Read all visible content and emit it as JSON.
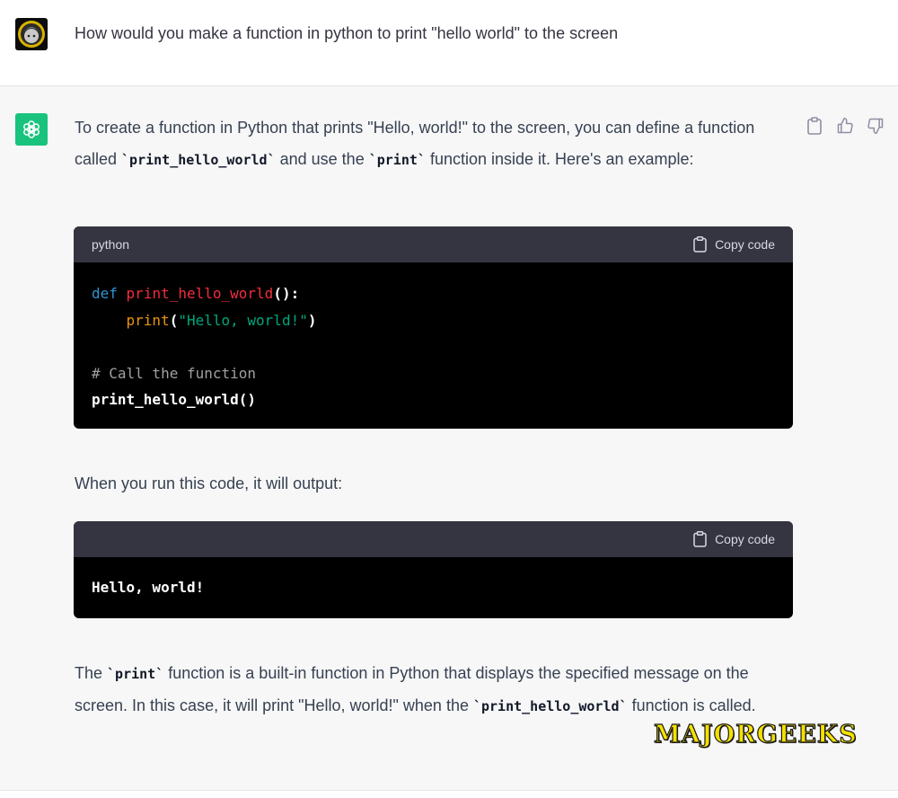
{
  "user_message": {
    "text": "How would you make a function in python to print \"hello world\" to the screen"
  },
  "assistant_message": {
    "intro": {
      "part1": "To create a function in Python that prints \"Hello, world!\" to the screen, you can define a function called ",
      "code1": "`print_hello_world`",
      "part2": " and use the ",
      "code2": "`print`",
      "part3": " function inside it. Here's an example:"
    },
    "code_block_1": {
      "language": "python",
      "copy_label": "Copy code",
      "tokens": {
        "def": "def",
        "fn_name": "print_hello_world",
        "sig_end": "():",
        "indent": "    ",
        "print_call": "print",
        "paren_open": "(",
        "string": "\"Hello, world!\"",
        "paren_close": ")",
        "comment": "# Call the function",
        "call": "print_hello_world()"
      }
    },
    "output_intro": "When you run this code, it will output:",
    "code_block_2": {
      "copy_label": "Copy code",
      "output": "Hello, world!"
    },
    "outro": {
      "part1": "The ",
      "code1": "`print`",
      "part2": " function is a built-in function in Python that displays the specified message on the screen. In this case, it will print \"Hello, world!\" when the ",
      "code2": "`print_hello_world`",
      "part3": " function is called."
    },
    "actions": [
      "clipboard-icon",
      "thumbs-up-icon",
      "thumbs-down-icon"
    ]
  },
  "watermark": "MAJORGEEKS",
  "colors": {
    "assistant_bg": "#f7f7f8",
    "bot_avatar": "#19c37d",
    "code_bg": "#000000",
    "code_header": "#343541",
    "keyword": "#2e95d3",
    "function_name": "#f22c3d",
    "builtin": "#e9950c",
    "string": "#00a67d",
    "comment": "#a0a0a0"
  }
}
